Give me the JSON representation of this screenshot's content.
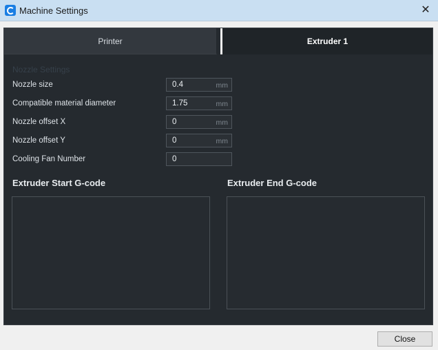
{
  "window": {
    "title": "Machine Settings",
    "app_icon": "cura-logo-icon",
    "close_icon": "close-icon",
    "close_glyph": "✕"
  },
  "tabs": [
    {
      "label": "Printer",
      "selected": false
    },
    {
      "label": "Extruder 1",
      "selected": true
    }
  ],
  "nozzle_settings": {
    "heading": "Nozzle Settings",
    "rows": [
      {
        "label": "Nozzle size",
        "value": "0.4",
        "unit": "mm"
      },
      {
        "label": "Compatible material diameter",
        "value": "1.75",
        "unit": "mm"
      },
      {
        "label": "Nozzle offset X",
        "value": "0",
        "unit": "mm"
      },
      {
        "label": "Nozzle offset Y",
        "value": "0",
        "unit": "mm"
      },
      {
        "label": "Cooling Fan Number",
        "value": "0",
        "unit": ""
      }
    ]
  },
  "gcode": {
    "start_label": "Extruder Start G-code",
    "end_label": "Extruder End G-code",
    "start_value": "",
    "end_value": ""
  },
  "footer": {
    "close_label": "Close"
  },
  "colors": {
    "titlebar": "#c9dff2",
    "panel_bg": "#252a2f",
    "field_bg": "#2b3035",
    "app_icon": "#1a7ee3"
  }
}
